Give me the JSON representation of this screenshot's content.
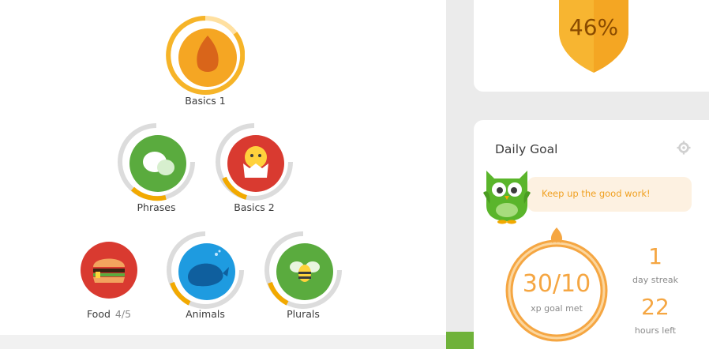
{
  "skills": [
    {
      "name": "Basics 1",
      "progress": "",
      "icon": "egg-icon",
      "color": "#f2a900"
    },
    {
      "name": "Phrases",
      "progress": "",
      "icon": "speech-bubbles-icon",
      "color": "#5aab3e"
    },
    {
      "name": "Basics 2",
      "progress": "",
      "icon": "chick-icon",
      "color": "#d93a30"
    },
    {
      "name": "Food",
      "progress": "4/5",
      "icon": "burger-icon",
      "color": "#d93a30"
    },
    {
      "name": "Animals",
      "progress": "",
      "icon": "whale-icon",
      "color": "#1e9be0"
    },
    {
      "name": "Plurals",
      "progress": "",
      "icon": "bee-icon",
      "color": "#5aab3e"
    }
  ],
  "shield": {
    "value": "46%",
    "icon": "shield-icon",
    "color": "#f7b531"
  },
  "daily_goal": {
    "title": "Daily Goal",
    "message": "Keep up the good work!",
    "goal_value": "30/10",
    "goal_caption": "xp goal met",
    "streak_value": "1",
    "streak_caption": "day streak",
    "hours_value": "22",
    "hours_caption": "hours left",
    "accent": "#f5a642"
  }
}
